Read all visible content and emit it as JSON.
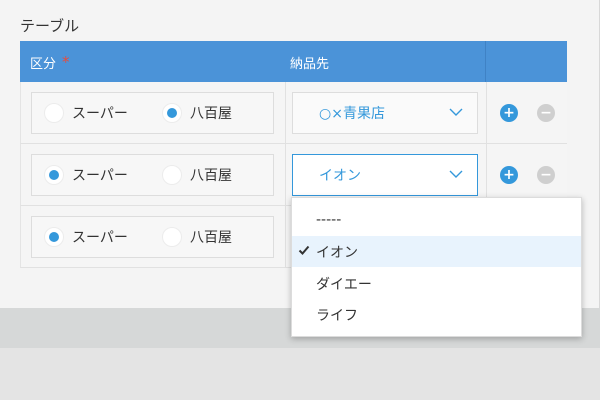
{
  "section_title": "テーブル",
  "table": {
    "headers": {
      "kubun": "区分",
      "required_mark": "*",
      "deliver": "納品先"
    },
    "radio_options": [
      "スーパー",
      "八百屋"
    ],
    "rows": [
      {
        "selected_option": "八百屋",
        "deliver_value": "○×青果店"
      },
      {
        "selected_option": "スーパー",
        "deliver_value": "イオン"
      },
      {
        "selected_option": "スーパー",
        "deliver_value": ""
      }
    ],
    "buttons": {
      "add": "+",
      "remove": "−"
    }
  },
  "dropdown": {
    "items": [
      "-----",
      "イオン",
      "ダイエー",
      "ライフ"
    ],
    "selected": "イオン"
  },
  "colors": {
    "accent": "#4b93d8",
    "radio_on": "#3498db",
    "required": "#e74c3c"
  }
}
